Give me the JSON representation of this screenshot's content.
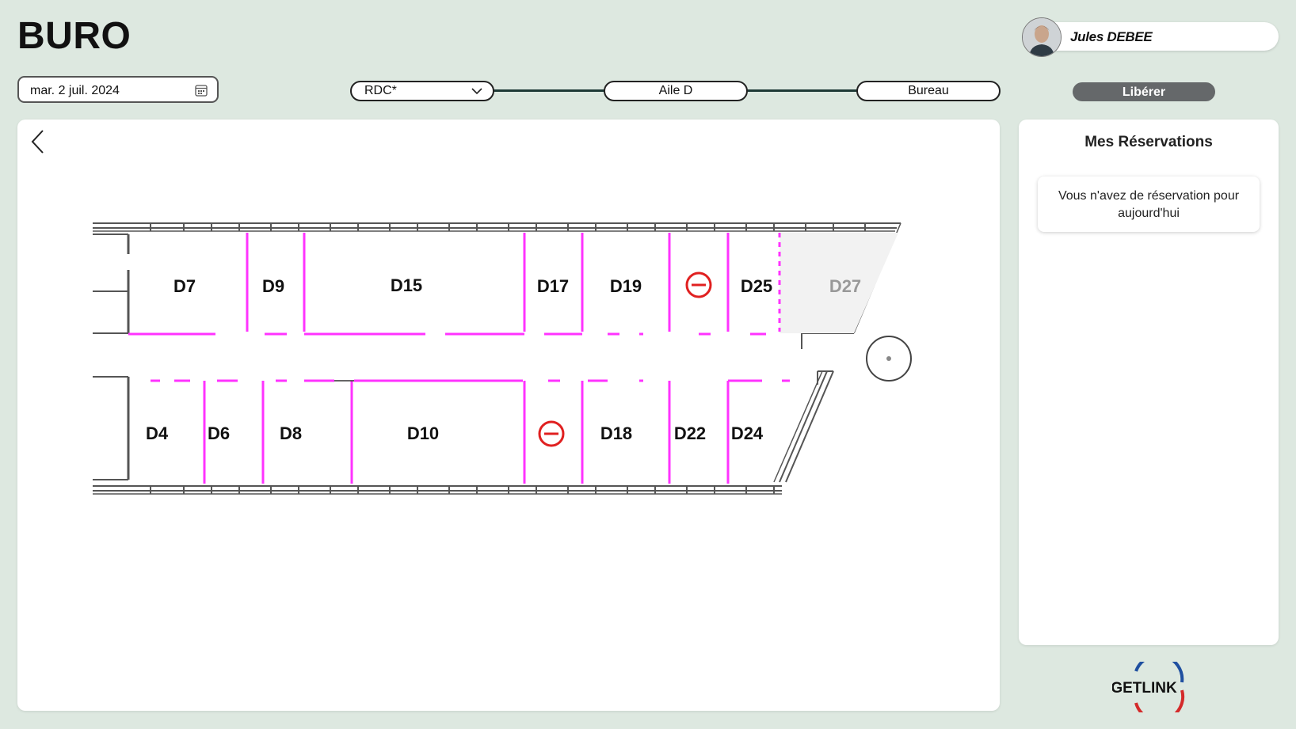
{
  "app": {
    "title": "BURO"
  },
  "user": {
    "name": "Jules DEBEE"
  },
  "date_picker": {
    "value": "mar. 2 juil. 2024",
    "icon": "calendar-icon"
  },
  "breadcrumb": {
    "floor": {
      "value": "RDC*",
      "icon": "chevron-down-icon"
    },
    "wing": {
      "label": "Aile D"
    },
    "room_type": {
      "label": "Bureau"
    }
  },
  "actions": {
    "release_label": "Libérer"
  },
  "floor_plan": {
    "desk_labels": {
      "D7": "D7",
      "D9": "D9",
      "D15": "D15",
      "D17": "D17",
      "D19": "D19",
      "D25": "D25",
      "D27": "D27",
      "D4": "D4",
      "D6": "D6",
      "D8": "D8",
      "D10": "D10",
      "D18": "D18",
      "D22": "D22",
      "D24": "D24"
    },
    "unavailable_icon": "no-entry-icon",
    "partition_color": "#ff33ff",
    "unavailable_color": "#e02020",
    "disabled_desk": "D27"
  },
  "reservations": {
    "title": "Mes Réservations",
    "empty_message": "Vous n'avez de réservation pour aujourd'hui"
  },
  "brand": {
    "logo_text": "GETLINK",
    "colors": [
      "#1f4fa0",
      "#d42a2a"
    ]
  }
}
